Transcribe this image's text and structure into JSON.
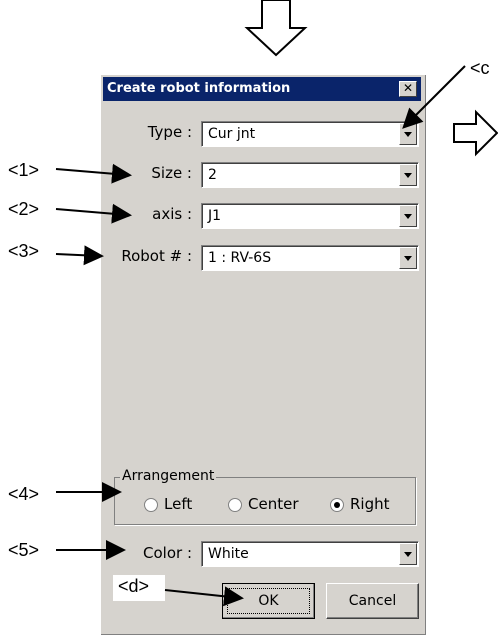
{
  "dialog": {
    "title": "Create robot information",
    "close_glyph": "✕",
    "fields": {
      "type": {
        "label": "Type :",
        "value": "Cur jnt"
      },
      "size": {
        "label": "Size :",
        "value": "2"
      },
      "axis": {
        "label": "axis :",
        "value": "J1"
      },
      "robot": {
        "label": "Robot # :",
        "value": "1 : RV-6S"
      },
      "color": {
        "label": "Color :",
        "value": "White"
      }
    },
    "arrangement": {
      "title": "Arrangement",
      "options": [
        "Left",
        "Center",
        "Right"
      ],
      "selected": "Right"
    },
    "buttons": {
      "ok": "OK",
      "cancel": "Cancel"
    }
  },
  "callouts": {
    "c": "<c",
    "one": "<1>",
    "two": "<2>",
    "three": "<3>",
    "four": "<4>",
    "five": "<5>",
    "d": "<d>"
  },
  "colors": {
    "titlebar": "#0a246a",
    "dialog_bg": "#d6d3ce"
  },
  "icons": [
    "down-arrow-icon",
    "right-arrow-icon",
    "close-icon",
    "chevron-down-icon"
  ]
}
